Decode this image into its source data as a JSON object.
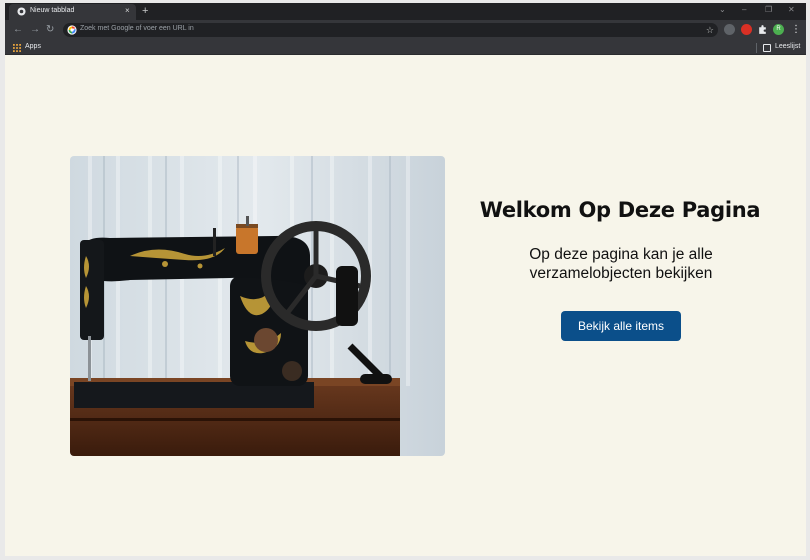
{
  "browser": {
    "tab_title": "Nieuw tabblad",
    "tab_close": "×",
    "new_tab": "+",
    "window_controls": [
      "⌄",
      "–",
      "❐",
      "✕"
    ],
    "nav": {
      "back": "←",
      "forward": "→",
      "reload": "↻"
    },
    "omnibox_placeholder": "Zoek met Google of voer een URL in",
    "star": "☆",
    "profile_initial": "R",
    "menu": "⋮",
    "bookmarks": {
      "apps_label": "Apps",
      "reading_list_label": "Leeslijst"
    },
    "colors": {
      "frame": "#202124",
      "toolbar": "#35363a",
      "profile": "#4caf50"
    }
  },
  "page": {
    "title": "Welkom Op Deze Pagina",
    "description": "Op deze pagina kan je alle verzamelobjecten bekijken",
    "button_label": "Bekijk alle items",
    "hero_image": "vintage-sewing-machine",
    "colors": {
      "background": "#f7f5ea",
      "button": "#0b4f8a"
    }
  }
}
